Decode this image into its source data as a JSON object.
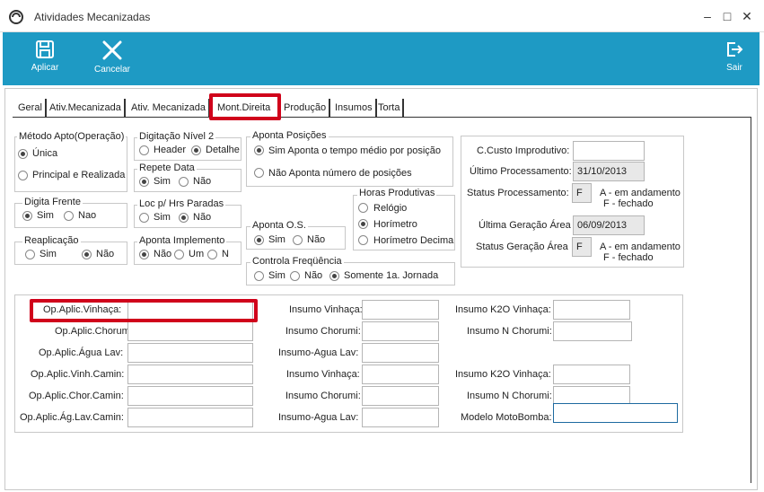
{
  "window": {
    "title": "Atividades Mecanizadas",
    "minimize": "–",
    "maximize": "□",
    "close": "✕"
  },
  "toolbar": {
    "apply_label": "Aplicar",
    "cancel_label": "Cancelar",
    "exit_label": "Sair"
  },
  "tabs": [
    "Geral",
    "Ativ.Mecanizada",
    "Ativ. Mecanizada",
    "Mont.Direita",
    "Produção",
    "Insumos",
    "Torta"
  ],
  "groups": {
    "metodo_apto": {
      "title": "Método Apto(Operação)",
      "opt1": "Única",
      "opt2": "Principal e Realizada"
    },
    "digitacao_nivel2": {
      "title": "Digitação Nível 2",
      "opt1": "Header",
      "opt2": "Detalhe"
    },
    "repete_data": {
      "title": "Repete Data",
      "opt1": "Sim",
      "opt2": "Não"
    },
    "aponta_posicoes": {
      "title": "Aponta Posições",
      "opt1": "Sim  Aponta o tempo médio por posição",
      "opt2": "Não  Aponta número de posições"
    },
    "digita_frente": {
      "title": "Digita Frente",
      "opt1": "Sim",
      "opt2": "Nao"
    },
    "loc_hrs_paradas": {
      "title": "Loc p/ Hrs Paradas",
      "opt1": "Sim",
      "opt2": "Não"
    },
    "horas_produtivas": {
      "title": "Horas Produtivas",
      "opt1": "Relógio",
      "opt2": "Horímetro",
      "opt3": "Horímetro Decimal"
    },
    "aponta_os": {
      "title": "Aponta O.S.",
      "opt1": "Sim",
      "opt2": "Não"
    },
    "reaplicacao": {
      "title": "Reaplicação",
      "opt1": "Sim",
      "opt2": "Não"
    },
    "aponta_implemento": {
      "title": "Aponta Implemento",
      "opt1": "Não",
      "opt2": "Um",
      "opt3": "N"
    },
    "controla_frequencia": {
      "title": "Controla Freqüência",
      "opt1": "Sim",
      "opt2": "Não",
      "opt3": "Somente 1a. Jornada"
    }
  },
  "status": {
    "ccusto_label": "C.Custo Improdutivo:",
    "ultimo_proc_label": "Último Processamento:",
    "ultimo_proc_value": "31/10/2013",
    "status_proc_label": "Status Processamento:",
    "status_proc_value": "F",
    "status_proc_legend1": "A - em andamento",
    "status_proc_legend2": "F - fechado",
    "ultima_ger_label": "Última Geração Área",
    "ultima_ger_value": "06/09/2013",
    "status_ger_label": "Status Geração Área",
    "status_ger_value": "F",
    "status_ger_legend1": "A - em andamento",
    "status_ger_legend2": "F - fechado"
  },
  "fields": {
    "col1": [
      "Op.Aplic.Vinhaça:",
      "Op.Aplic.Chorumi:",
      "Op.Aplic.Água Lav:",
      "Op.Aplic.Vinh.Camin:",
      "Op.Aplic.Chor.Camin:",
      "Op.Aplic.Ág.Lav.Camin:"
    ],
    "col2": [
      "Insumo Vinhaça:",
      "Insumo Chorumi:",
      "Insumo-Agua Lav:",
      "Insumo Vinhaça:",
      "Insumo Chorumi:",
      "Insumo-Agua Lav:"
    ],
    "col3": [
      "Insumo K2O Vinhaça:",
      "Insumo N Chorumi:",
      "Insumo K2O Vinhaça:",
      "Insumo N Chorumi:",
      "Modelo MotoBomba:"
    ]
  }
}
